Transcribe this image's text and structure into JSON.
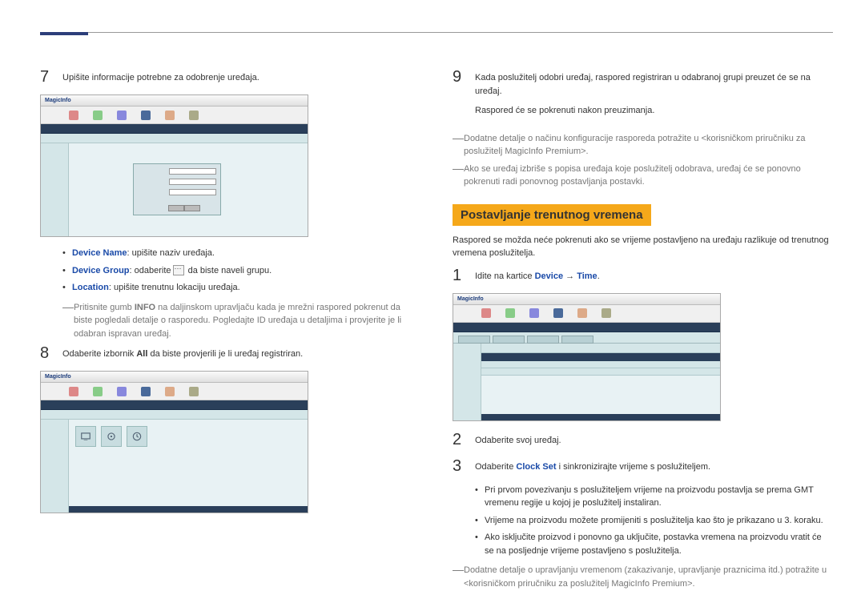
{
  "leftCol": {
    "step7": "Upišite informacije potrebne za odobrenje uređaja.",
    "bullets": {
      "deviceName": {
        "label": "Device Name",
        "text": ": upišite naziv uređaja."
      },
      "deviceGroup": {
        "label": "Device Group",
        "pre": ": odaberite",
        "post": " da biste naveli grupu."
      },
      "location": {
        "label": "Location",
        "text": ": upišite trenutnu lokaciju uređaja."
      }
    },
    "note7": {
      "pre": "Pritisnite gumb ",
      "bold": "INFO",
      "post": " na daljinskom upravljaču kada je mrežni raspored pokrenut da biste pogledali detalje o rasporedu. Pogledajte ID uređaja u detaljima i provjerite je li odabran ispravan uređaj."
    },
    "step8": {
      "pre": "Odaberite izbornik ",
      "bold": "All",
      "post": " da biste provjerili je li uređaj registriran."
    }
  },
  "rightCol": {
    "step9": {
      "line1": "Kada poslužitelj odobri uređaj, raspored registriran u odabranoj grupi preuzet će se na uređaj.",
      "line2": "Raspored će se pokrenuti nakon preuzimanja."
    },
    "note9a": "Dodatne detalje o načinu konfiguracije rasporeda potražite u <korisničkom priručniku za poslužitelj MagicInfo Premium>.",
    "note9b": "Ako se uređaj izbriše s popisa uređaja koje poslužitelj odobrava, uređaj će se ponovno pokrenuti radi ponovnog postavljanja postavki.",
    "sectionTitle": "Postavljanje trenutnog vremena",
    "sectionPara": "Raspored se možda neće pokrenuti ako se vrijeme postavljeno na uređaju razlikuje od trenutnog vremena poslužitelja.",
    "step1": {
      "pre": "Idite na kartice ",
      "b1": "Device",
      "mid": " → ",
      "b2": "Time",
      "post": "."
    },
    "step2": "Odaberite svoj uređaj.",
    "step3": {
      "pre": "Odaberite ",
      "bold": "Clock Set",
      "post": " i sinkronizirajte vrijeme s poslužiteljem."
    },
    "bullets": {
      "b1": "Pri prvom povezivanju s poslužiteljem vrijeme na proizvodu postavlja se prema GMT vremenu regije u kojoj je poslužitelj instaliran.",
      "b2": "Vrijeme na proizvodu možete promijeniti s poslužitelja kao što je prikazano u 3. koraku.",
      "b3": "Ako isključite proizvod i ponovno ga uključite, postavka vremena na proizvodu vratit će se na posljednje vrijeme postavljeno s poslužitelja."
    },
    "noteFinal": "Dodatne detalje o upravljanju vremenom (zakazivanje, upravljanje praznicima itd.) potražite u <korisničkom priručniku za poslužitelj MagicInfo Premium>."
  },
  "ss": {
    "logo": "MagicInfo"
  }
}
